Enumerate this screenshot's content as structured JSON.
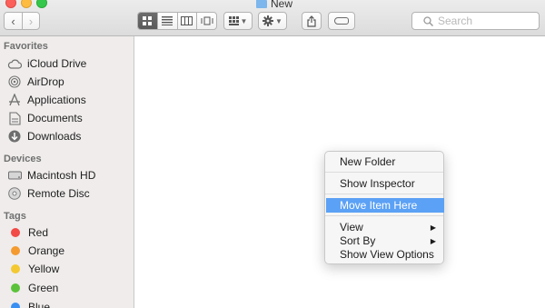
{
  "window": {
    "title": "New"
  },
  "toolbar": {
    "back_glyph": "‹",
    "forward_glyph": "›",
    "view_modes": [
      {
        "id": "icon",
        "icon": "icon-view-icon",
        "active": true
      },
      {
        "id": "list",
        "icon": "list-view-icon",
        "active": false
      },
      {
        "id": "column",
        "icon": "column-view-icon",
        "active": false
      },
      {
        "id": "coverflow",
        "icon": "cover-flow-view-icon",
        "active": false
      }
    ],
    "arrange_icon": "arrange-grid-icon",
    "action_icon": "gear-icon",
    "share_icon": "share-icon",
    "tags_icon": "tag-icon",
    "search_placeholder": "Search"
  },
  "sidebar": {
    "favorites_heading": "Favorites",
    "favorites": [
      {
        "label": "iCloud Drive",
        "icon": "cloud-icon"
      },
      {
        "label": "AirDrop",
        "icon": "airdrop-icon"
      },
      {
        "label": "Applications",
        "icon": "applications-icon"
      },
      {
        "label": "Documents",
        "icon": "documents-icon"
      },
      {
        "label": "Downloads",
        "icon": "downloads-icon"
      }
    ],
    "devices_heading": "Devices",
    "devices": [
      {
        "label": "Macintosh HD",
        "icon": "hard-drive-icon"
      },
      {
        "label": "Remote Disc",
        "icon": "disc-icon"
      }
    ],
    "tags_heading": "Tags",
    "tags": [
      {
        "label": "Red",
        "color": "#f24a45"
      },
      {
        "label": "Orange",
        "color": "#f49a2f"
      },
      {
        "label": "Yellow",
        "color": "#f3c832"
      },
      {
        "label": "Green",
        "color": "#5cc23b"
      },
      {
        "label": "Blue",
        "color": "#3a8ff2"
      }
    ]
  },
  "context_menu": {
    "items": [
      {
        "label": "New Folder"
      },
      {
        "label": "Show Inspector"
      },
      {
        "label": "Move Item Here",
        "highlighted": true
      },
      {
        "label": "View",
        "submenu": true
      },
      {
        "label": "Sort By",
        "submenu": true
      },
      {
        "label": "Show View Options"
      }
    ],
    "submenu_glyph": "▶"
  },
  "colors": {
    "highlight": "#5ba1f5",
    "sidebar_bg": "#efeceb"
  }
}
